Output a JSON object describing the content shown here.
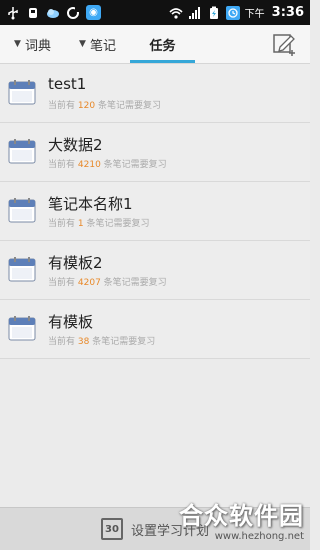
{
  "status_bar": {
    "time": "3:36",
    "ampm": "下午",
    "icons": [
      "usb-icon",
      "usb-debug-icon",
      "cloud-icon",
      "sync-icon",
      "app-badge-icon",
      "wifi-icon",
      "signal-icon",
      "battery-charging-icon",
      "alarm-icon"
    ]
  },
  "tabs": [
    {
      "label": "词典",
      "has_arrow": true,
      "active": false
    },
    {
      "label": "笔记",
      "has_arrow": true,
      "active": false
    },
    {
      "label": "任务",
      "has_arrow": false,
      "active": true
    }
  ],
  "list": {
    "prefix": "当前有",
    "suffix": "条笔记需要复习",
    "items": [
      {
        "title": "test1",
        "count": "120"
      },
      {
        "title": "大数据2",
        "count": "4210"
      },
      {
        "title": "笔记本名称1",
        "count": "1"
      },
      {
        "title": "有模板2",
        "count": "4207"
      },
      {
        "title": "有模板",
        "count": "38"
      }
    ]
  },
  "bottom": {
    "icon_number": "30",
    "label": "设置学习计划"
  },
  "watermark": {
    "title": "合众软件园",
    "url": "www.hezhong.net"
  },
  "colors": {
    "accent": "#35a7d8",
    "count": "#e8892a"
  }
}
